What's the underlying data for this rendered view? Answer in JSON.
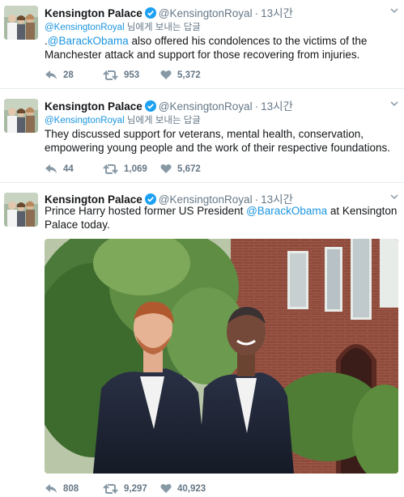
{
  "account": {
    "name": "Kensington Palace",
    "handle": "@KensingtonRoyal"
  },
  "colors": {
    "link": "#1b95e0",
    "verified": "#1da1f2",
    "muted": "#657786"
  },
  "tweets": [
    {
      "time": "13시간",
      "reply_handle": "@KensingtonRoyal",
      "reply_suffix": " 님에게 보내는 답글",
      "text_pre": ".",
      "mention": "@BarackObama",
      "text_post": " also offered his condolences to the victims of the Manchester attack and support for those recovering from injuries.",
      "replies": "28",
      "retweets": "953",
      "likes": "5,372"
    },
    {
      "time": "13시간",
      "reply_handle": "@KensingtonRoyal",
      "reply_suffix": " 님에게 보내는 답글",
      "text": "They discussed support for veterans, mental health, conservation, empowering young people and the work of their respective foundations.",
      "replies": "44",
      "retweets": "1,069",
      "likes": "5,672"
    },
    {
      "time": "13시간",
      "text_pre": "Prince Harry hosted former US President ",
      "mention": "@BarackObama",
      "text_post": " at Kensington Palace today.",
      "replies": "808",
      "retweets": "9,297",
      "likes": "40,923"
    }
  ],
  "icons": {
    "reply": "reply-icon",
    "retweet": "retweet-icon",
    "like": "heart-icon",
    "verified": "verified-badge-icon",
    "more": "chevron-down-icon"
  }
}
